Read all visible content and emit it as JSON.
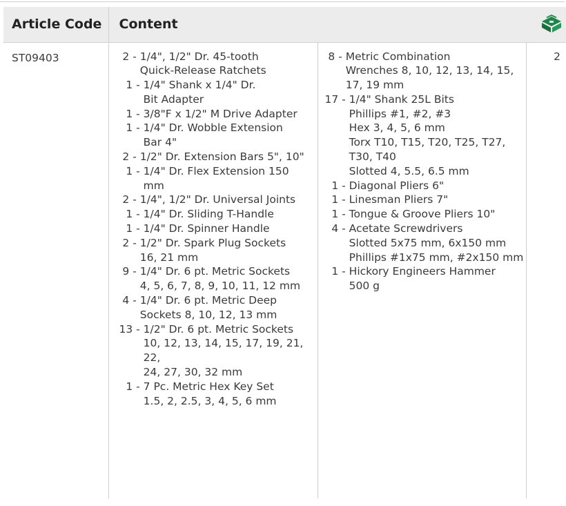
{
  "header": {
    "article_code": "Article Code",
    "content": "Content",
    "icon": "toolbox-icon",
    "icon_color": "#1e8449"
  },
  "row": {
    "article_code": "ST09403",
    "quantity": "2",
    "column1": [
      {
        "num": " 2 - ",
        "lines": [
          "1/4\", 1/2\" Dr. 45-tooth",
          "Quick-Release Ratchets"
        ]
      },
      {
        "num": "  1 - ",
        "lines": [
          "1/4\" Shank x 1/4\" Dr.",
          "Bit Adapter"
        ]
      },
      {
        "num": "  1 - ",
        "lines": [
          "3/8\"F x 1/2\" M Drive Adapter"
        ]
      },
      {
        "num": "  1 - ",
        "lines": [
          "1/4\" Dr. Wobble Extension",
          "Bar 4\""
        ]
      },
      {
        "num": " 2 - ",
        "lines": [
          "1/2\" Dr. Extension Bars 5\", 10\""
        ]
      },
      {
        "num": "  1 - ",
        "lines": [
          "1/4\" Dr. Flex Extension 150",
          "mm"
        ]
      },
      {
        "num": " 2 - ",
        "lines": [
          "1/4\", 1/2\" Dr. Universal Joints"
        ]
      },
      {
        "num": "  1 - ",
        "lines": [
          "1/4\" Dr. Sliding T-Handle"
        ]
      },
      {
        "num": "  1 - ",
        "lines": [
          "1/4\" Dr. Spinner Handle"
        ]
      },
      {
        "num": " 2 - ",
        "lines": [
          "1/2\" Dr. Spark Plug Sockets",
          "16, 21 mm"
        ]
      },
      {
        "num": " 9 - ",
        "lines": [
          "1/4\" Dr. 6 pt. Metric Sockets",
          "4, 5, 6, 7, 8, 9, 10, 11, 12 mm"
        ]
      },
      {
        "num": " 4 - ",
        "lines": [
          "1/4\" Dr. 6 pt. Metric Deep",
          "Sockets 8, 10, 12, 13 mm"
        ]
      },
      {
        "num": "13 - ",
        "lines": [
          "1/2\" Dr. 6 pt. Metric Sockets",
          "10, 12, 13, 14, 15, 17, 19, 21, 22,",
          "24, 27, 30, 32 mm"
        ]
      },
      {
        "num": "  1 - ",
        "lines": [
          "7 Pc. Metric Hex Key Set",
          "1.5, 2, 2.5, 3, 4, 5, 6 mm"
        ]
      }
    ],
    "column2": [
      {
        "num": " 8 - ",
        "lines": [
          "Metric Combination",
          "Wrenches 8, 10, 12, 13, 14, 15,",
          "17, 19 mm"
        ]
      },
      {
        "num": "17 - ",
        "lines": [
          "1/4\" Shank 25L Bits",
          "Phillips #1, #2, #3",
          "Hex 3, 4, 5, 6 mm",
          "Torx T10, T15, T20, T25, T27,",
          "T30, T40",
          "Slotted 4, 5.5, 6.5 mm"
        ]
      },
      {
        "num": "  1 - ",
        "lines": [
          "Diagonal Pliers 6\""
        ]
      },
      {
        "num": "  1 - ",
        "lines": [
          "Linesman Pliers 7\""
        ]
      },
      {
        "num": "  1 - ",
        "lines": [
          "Tongue & Groove Pliers 10\""
        ]
      },
      {
        "num": "  4 - ",
        "lines": [
          "Acetate Screwdrivers",
          "Slotted 5x75 mm, 6x150 mm",
          "Phillips #1x75 mm, #2x150 mm"
        ]
      },
      {
        "num": "  1 - ",
        "lines": [
          "Hickory Engineers Hammer",
          "500 g"
        ]
      }
    ]
  }
}
